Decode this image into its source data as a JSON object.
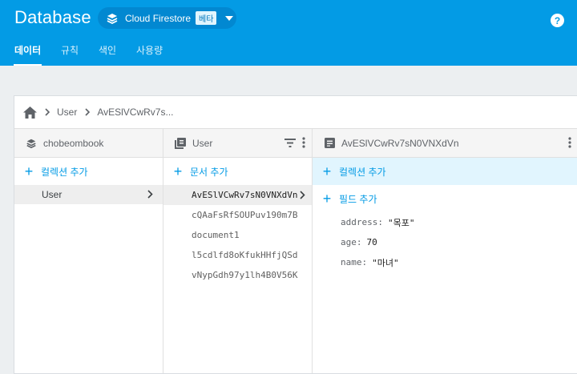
{
  "header": {
    "title": "Database",
    "db_selector": {
      "label": "Cloud Firestore",
      "badge": "베타"
    },
    "help_label": "?"
  },
  "tabs": [
    {
      "label": "데이터",
      "active": true
    },
    {
      "label": "규칙",
      "active": false
    },
    {
      "label": "색인",
      "active": false
    },
    {
      "label": "사용량",
      "active": false
    }
  ],
  "breadcrumb": {
    "items": [
      "User",
      "AvESlVCwRv7s..."
    ]
  },
  "columns": {
    "root": {
      "title": "chobeombook",
      "add_label": "컬렉션 추가",
      "items": [
        {
          "label": "User",
          "selected": true
        }
      ]
    },
    "collection": {
      "title": "User",
      "add_label": "문서 추가",
      "items": [
        {
          "label": "AvESlVCwRv7sN0VNXdVn",
          "selected": true
        },
        {
          "label": "cQAaFsRfSOUPuv190m7B",
          "selected": false
        },
        {
          "label": "document1",
          "selected": false
        },
        {
          "label": "l5cdlfd8oKfukHHfjQSd",
          "selected": false
        },
        {
          "label": "vNypGdh97y1lh4B0V56K",
          "selected": false
        }
      ]
    },
    "document": {
      "title": "AvESlVCwRv7sN0VNXdVn",
      "add_collection_label": "컬렉션 추가",
      "add_field_label": "필드 추가",
      "fields": [
        {
          "key": "address:",
          "value": "\"목포\""
        },
        {
          "key": "age:",
          "value": "70"
        },
        {
          "key": "name:",
          "value": "\"마녀\""
        }
      ]
    }
  },
  "colors": {
    "primary": "#039be5",
    "highlight": "#e1f5fe",
    "background": "#eceff1"
  }
}
